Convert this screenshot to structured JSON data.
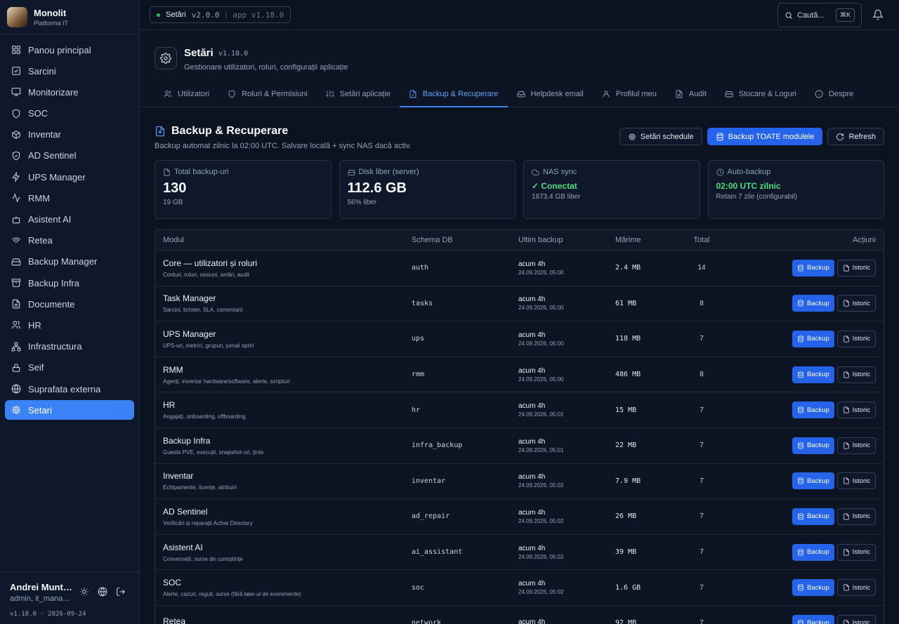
{
  "brand": {
    "title": "Monolit",
    "subtitle": "Platforma IT"
  },
  "nav": [
    {
      "label": "Panou principal",
      "icon": "grid-icon"
    },
    {
      "label": "Sarcini",
      "icon": "checkbox-icon"
    },
    {
      "label": "Monitorizare",
      "icon": "monitor-icon"
    },
    {
      "label": "SOC",
      "icon": "shield-icon"
    },
    {
      "label": "Inventar",
      "icon": "box-icon"
    },
    {
      "label": "AD Sentinel",
      "icon": "shield-check-icon"
    },
    {
      "label": "UPS Manager",
      "icon": "bolt-icon"
    },
    {
      "label": "RMM",
      "icon": "activity-icon"
    },
    {
      "label": "Asistent AI",
      "icon": "robot-icon"
    },
    {
      "label": "Retea",
      "icon": "wifi-icon"
    },
    {
      "label": "Backup Manager",
      "icon": "hdd-icon"
    },
    {
      "label": "Backup Infra",
      "icon": "archive-icon"
    },
    {
      "label": "Documente",
      "icon": "document-icon"
    },
    {
      "label": "HR",
      "icon": "users-icon"
    },
    {
      "label": "Infrastructura",
      "icon": "network-icon"
    },
    {
      "label": "Seif",
      "icon": "lock-icon"
    },
    {
      "label": "Suprafata externa",
      "icon": "globe-icon"
    },
    {
      "label": "Setari",
      "icon": "gear-icon",
      "active": true
    }
  ],
  "user": {
    "name": "Andrei Munt…",
    "role": "admin, it_mana…",
    "version": "v1.18.0 · 2026-09-24"
  },
  "topbar": {
    "app_name": "Setări",
    "app_version": "v2.0.0",
    "sep": "|",
    "app_label": "app v1.18.0",
    "search_placeholder": "Caută...",
    "shortcut": "⌘K"
  },
  "header": {
    "title": "Setări",
    "version": "v1.18.0",
    "subtitle": "Gestionare utilizatori, roluri, configurații aplicație"
  },
  "tabs": [
    {
      "label": "Utilizatori",
      "icon": "users-icon"
    },
    {
      "label": "Roluri & Permisiuni",
      "icon": "shield-icon"
    },
    {
      "label": "Setări aplicație",
      "icon": "sliders-icon"
    },
    {
      "label": "Backup & Recuperare",
      "icon": "file-backup-icon",
      "active": true
    },
    {
      "label": "Helpdesk email",
      "icon": "inbox-icon"
    },
    {
      "label": "Profilul meu",
      "icon": "user-icon"
    },
    {
      "label": "Audit",
      "icon": "document-icon"
    },
    {
      "label": "Stocare & Loguri",
      "icon": "hdd-icon"
    },
    {
      "label": "Despre",
      "icon": "info-icon"
    }
  ],
  "section": {
    "title": "Backup & Recuperare",
    "subtitle": "Backup automat zilnic la 02:00 UTC. Salvare locală + sync NAS dacă activ."
  },
  "actions": {
    "schedule": "Setări schedule",
    "backup_all": "Backup TOATE modulele",
    "refresh": "Refresh"
  },
  "stats": [
    {
      "label": "Total backup-uri",
      "value": "130",
      "sub": "19 GB",
      "icon": "file-icon"
    },
    {
      "label": "Disk liber (server)",
      "value": "112.6 GB",
      "sub": "56% liber",
      "icon": "hdd-icon"
    },
    {
      "label": "NAS sync",
      "value": "✓ Conectat",
      "sub": "1873.4 GB liber",
      "icon": "cloud-icon",
      "green": true
    },
    {
      "label": "Auto-backup",
      "value": "02:00 UTC zilnic",
      "sub": "Retain 7 zile (configurabil)",
      "icon": "clock-icon",
      "green": true
    }
  ],
  "table": {
    "headers": [
      "Modul",
      "Schema DB",
      "Ultim backup",
      "Mărime",
      "Total",
      "Acțiuni"
    ],
    "backup_label": "Backup",
    "history_label": "Istoric",
    "rows": [
      {
        "name": "Core — utilizatori și roluri",
        "desc": "Conturi, roluri, sesiuni, setări, audit",
        "schema": "auth",
        "last": "acum 4h",
        "date": "24.09.2026, 05:00",
        "size": "2.4 MB",
        "total": "14"
      },
      {
        "name": "Task Manager",
        "desc": "Sarcini, tichete, SLA, comentarii",
        "schema": "tasks",
        "last": "acum 4h",
        "date": "24.09.2026, 05:00",
        "size": "61 MB",
        "total": "8"
      },
      {
        "name": "UPS Manager",
        "desc": "UPS-uri, metrici, grupuri, jurnal opriri",
        "schema": "ups",
        "last": "acum 4h",
        "date": "24.09.2026, 05:00",
        "size": "118 MB",
        "total": "7"
      },
      {
        "name": "RMM",
        "desc": "Agenți, inventar hardware/software, alerte, scripturi",
        "schema": "rmm",
        "last": "acum 4h",
        "date": "24.09.2026, 05:00",
        "size": "486 MB",
        "total": "8"
      },
      {
        "name": "HR",
        "desc": "Angajați, onboarding, offboarding",
        "schema": "hr",
        "last": "acum 4h",
        "date": "24.09.2026, 05:01",
        "size": "15 MB",
        "total": "7"
      },
      {
        "name": "Backup Infra",
        "desc": "Guests PVE, execuții, snapshot-uri, ținte",
        "schema": "infra_backup",
        "last": "acum 4h",
        "date": "24.09.2026, 05:01",
        "size": "22 MB",
        "total": "7"
      },
      {
        "name": "Inventar",
        "desc": "Echipamente, licențe, atribuiri",
        "schema": "inventar",
        "last": "acum 4h",
        "date": "24.09.2026, 05:02",
        "size": "7.9 MB",
        "total": "7"
      },
      {
        "name": "AD Sentinel",
        "desc": "Verificări și reparații Active Directory",
        "schema": "ad_repair",
        "last": "acum 4h",
        "date": "24.09.2026, 05:02",
        "size": "26 MB",
        "total": "7"
      },
      {
        "name": "Asistent AI",
        "desc": "Conversații, surse de cunoștințe",
        "schema": "ai_assistant",
        "last": "acum 4h",
        "date": "24.09.2026, 05:02",
        "size": "39 MB",
        "total": "7"
      },
      {
        "name": "SOC",
        "desc": "Alerte, cazuri, reguli, surse (fără lake-ul de evenimente)",
        "schema": "soc",
        "last": "acum 4h",
        "date": "24.09.2026, 05:02",
        "size": "1.6 GB",
        "total": "7"
      },
      {
        "name": "Rețea",
        "desc": "",
        "schema": "network",
        "last": "acum 4h",
        "date": "",
        "size": "92 MB",
        "total": "7"
      }
    ]
  }
}
